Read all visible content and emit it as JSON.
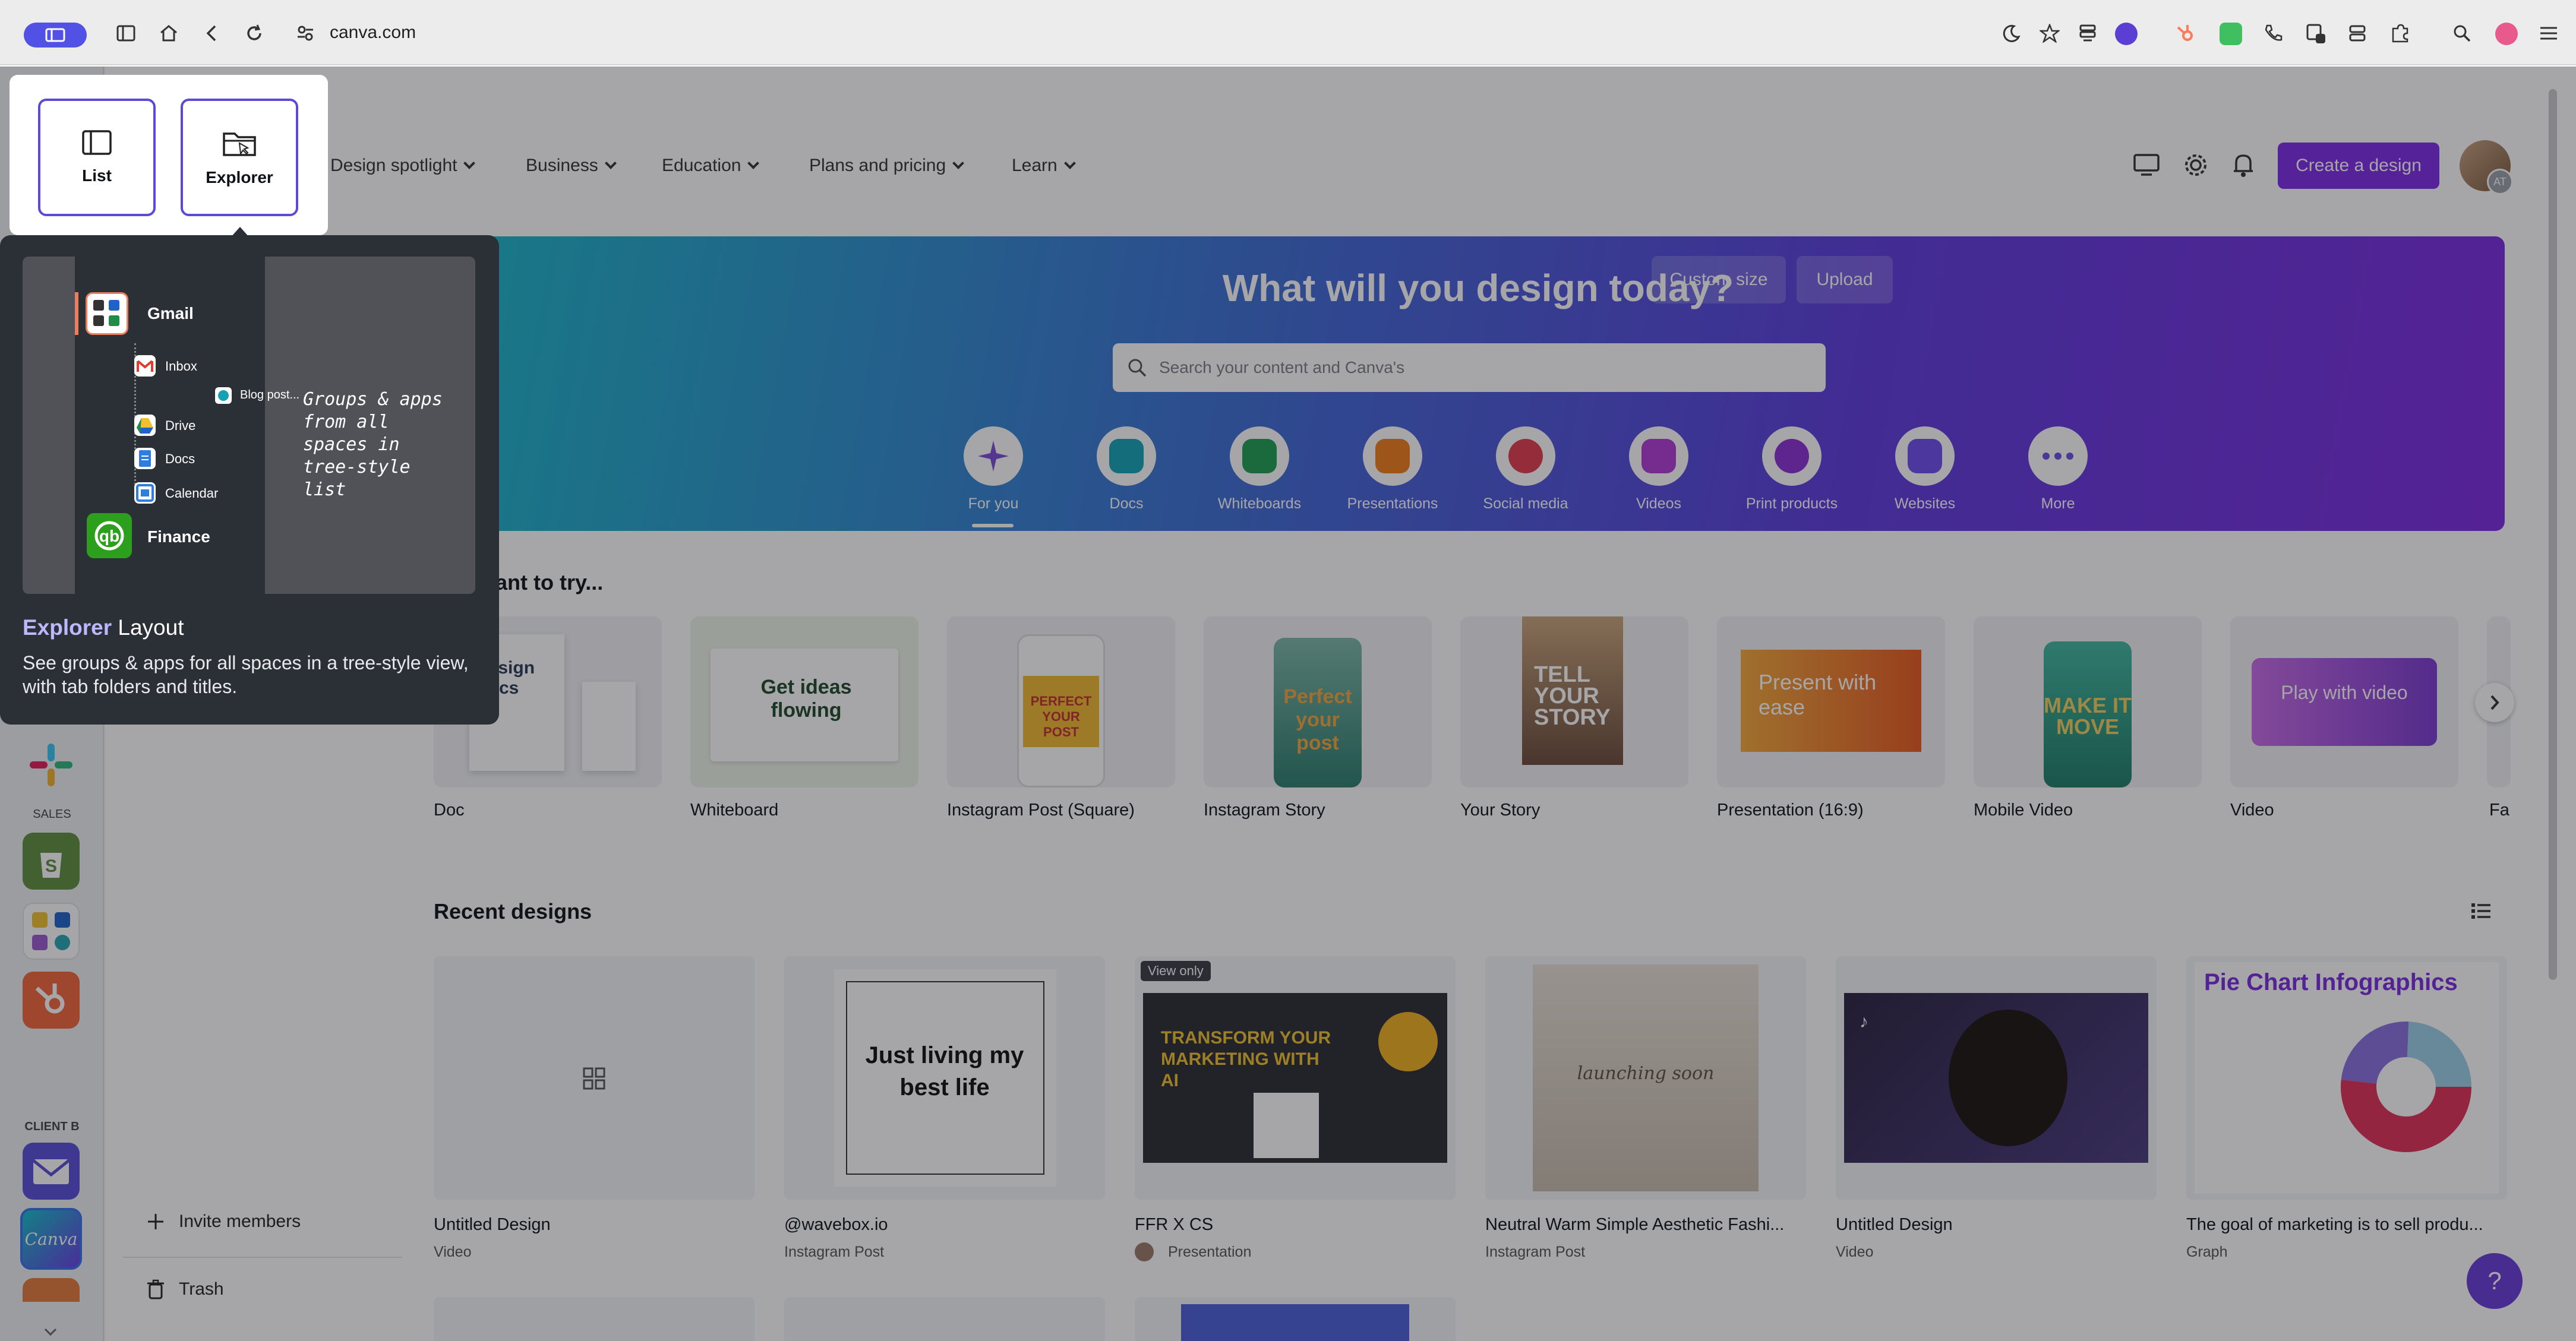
{
  "browser": {
    "url": "canva.com"
  },
  "nav": {
    "items": [
      "Design spotlight",
      "Business",
      "Education",
      "Plans and pricing",
      "Learn"
    ],
    "create_label": "Create a design",
    "avatar_initials": "AT"
  },
  "hero": {
    "title": "What will you design today?",
    "search_placeholder": "Search your content and Canva's",
    "custom_size": "Custom size",
    "upload": "Upload",
    "categories": [
      {
        "label": "For you",
        "color": "#7b4cd6"
      },
      {
        "label": "Docs",
        "color": "#13a3b5"
      },
      {
        "label": "Whiteboards",
        "color": "#1e9e55"
      },
      {
        "label": "Presentations",
        "color": "#f07d1b"
      },
      {
        "label": "Social media",
        "color": "#e23b4e"
      },
      {
        "label": "Videos",
        "color": "#b03bd6"
      },
      {
        "label": "Print products",
        "color": "#8d2fd6"
      },
      {
        "label": "Websites",
        "color": "#6f4cf0"
      },
      {
        "label": "More",
        "color": "#6d4ce0"
      }
    ]
  },
  "try_section": {
    "title": "ight want to try...",
    "tiles": [
      "Doc",
      "Whiteboard",
      "Instagram Post (Square)",
      "Instagram Story",
      "Your Story",
      "Presentation (16:9)",
      "Mobile Video",
      "Video",
      "Fa"
    ],
    "tile_texts": {
      "doc": "Design Docs",
      "whiteboard": "Get ideas flowing",
      "insta_post": "PERFECT YOUR POST",
      "insta_story": "Perfect your post",
      "your_story": "TELL YOUR STORY",
      "presentation": "Present with ease",
      "mobile_video": "MAKE IT MOVE",
      "video": "Play with video"
    }
  },
  "recent": {
    "title": "Recent designs",
    "view_only": "View only",
    "items": [
      {
        "name": "Untitled Design",
        "type": "Video"
      },
      {
        "name": "@wavebox.io",
        "type": "Instagram Post",
        "thumb_text": "Just living my best life"
      },
      {
        "name": "FFR X CS",
        "type": "Presentation",
        "thumb_text": "TRANSFORM YOUR MARKETING WITH AI"
      },
      {
        "name": "Neutral Warm Simple Aesthetic Fashi...",
        "type": "Instagram Post",
        "thumb_text": "launching soon"
      },
      {
        "name": "Untitled Design",
        "type": "Video"
      },
      {
        "name": "The goal of marketing is to sell produ...",
        "type": "Graph",
        "thumb_text": "Pie Chart Infographics"
      }
    ]
  },
  "sidebar": {
    "invite": "Invite members",
    "trash": "Trash",
    "rail_sections": [
      "SALES",
      "CLIENT B"
    ],
    "canva_label": "Canva"
  },
  "layout_picker": {
    "list_label": "List",
    "explorer_label": "Explorer"
  },
  "explorer_tip": {
    "title_bold": "Explorer",
    "title_rest": " Layout",
    "description": "See groups & apps for all spaces in a tree-style view, with tab folders and titles.",
    "note": "Groups & apps from all spaces in tree-style list",
    "tree": {
      "group": "Gmail",
      "inbox": "Inbox",
      "blog": "Blog post...",
      "drive": "Drive",
      "docs": "Docs",
      "calendar": "Calendar",
      "finance": "Finance"
    }
  },
  "help_label": "?"
}
